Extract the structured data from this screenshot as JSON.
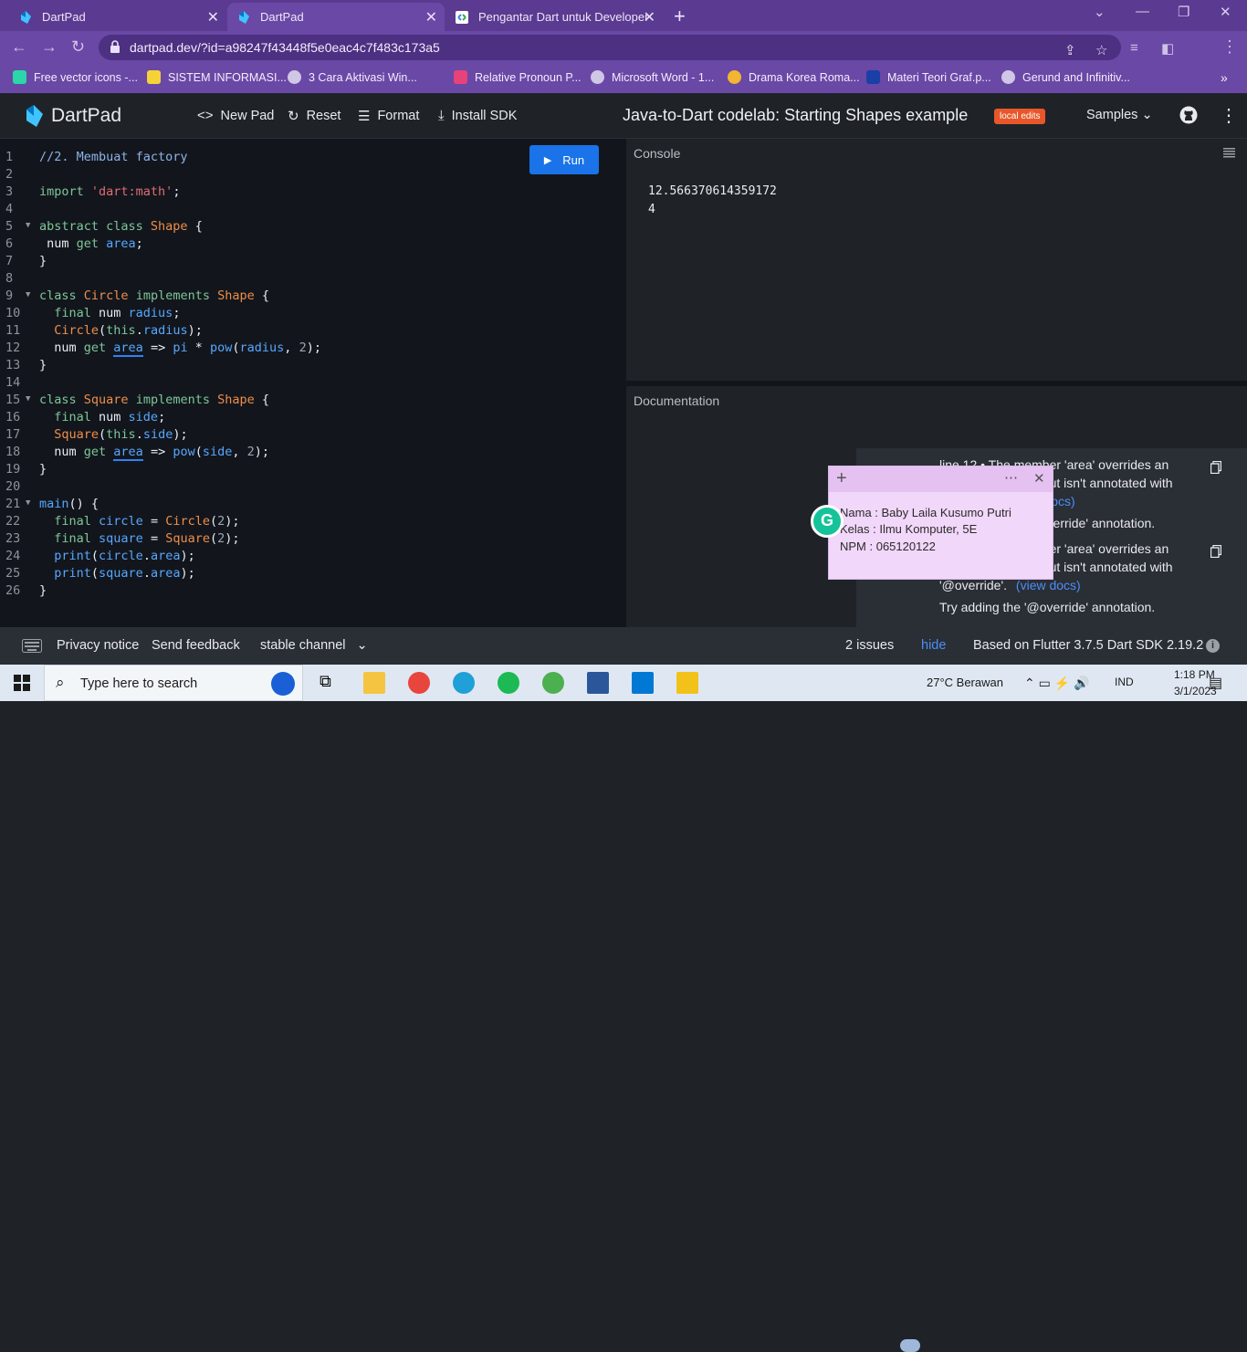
{
  "browser": {
    "tabs": [
      {
        "title": "DartPad",
        "active": false
      },
      {
        "title": "DartPad",
        "active": true
      },
      {
        "title": "Pengantar Dart untuk Developer",
        "active": false
      }
    ],
    "url": "dartpad.dev/?id=a98247f43448f5e0eac4c7f483c173a5",
    "bookmarks": [
      "Free vector icons -...",
      "SISTEM INFORMASI...",
      "3 Cara Aktivasi Win...",
      "Relative Pronoun P...",
      "Microsoft Word - 1...",
      "Drama Korea Roma...",
      "Materi Teori Graf.p...",
      "Gerund and Infinitiv..."
    ]
  },
  "dartpad": {
    "logo_text": "DartPad",
    "actions": {
      "new_pad": "New Pad",
      "reset": "Reset",
      "format": "Format",
      "install_sdk": "Install SDK"
    },
    "pad_title": "Java-to-Dart codelab: Starting Shapes example",
    "badge": "local edits",
    "samples": "Samples",
    "run": "Run",
    "console_title": "Console",
    "console_output": [
      "12.566370614359172",
      "4"
    ],
    "documentation_title": "Documentation",
    "issues": {
      "line1a": "line 12 • The member 'area' overrides an",
      "line1b": "inherited member but isn't annotated with",
      "line1c": "'@override'. (view docs)",
      "line1d": "Try adding the '@override' annotation.",
      "line2a": "line 18 • The member 'area' overrides an",
      "line2b": "inherited member but isn't annotated with",
      "line2c": "'@override'.",
      "line2c_link": "(view docs)",
      "line2d": "Try adding the '@override' annotation."
    }
  },
  "sticky_note": {
    "lines": [
      "Nama : Baby Laila Kusumo Putri",
      "Kelas  : Ilmu Komputer, 5E",
      "NPM : 065120122"
    ]
  },
  "footer": {
    "privacy": "Privacy notice",
    "feedback": "Send feedback",
    "channel": "stable channel",
    "issues_count": "2 issues",
    "hide": "hide",
    "version": "Based on Flutter 3.7.5 Dart SDK 2.19.2"
  },
  "taskbar": {
    "search_placeholder": "Type here to search",
    "weather": "27°C  Berawan",
    "lang": "IND",
    "time": "1:18 PM",
    "date": "3/1/2023"
  },
  "colors": {
    "browser_frame": "#5b3a91",
    "editor_bg": "#12161c",
    "run_button": "#1a73e8",
    "badge": "#e8572a",
    "sticky": "#f1d7f9"
  }
}
